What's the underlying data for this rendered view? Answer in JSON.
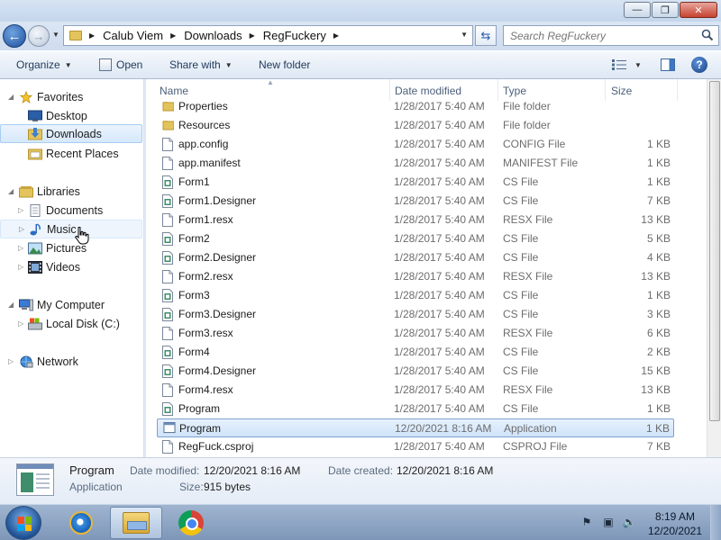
{
  "window": {
    "controls": {
      "minimize": "—",
      "maximize": "❐",
      "close": "✕"
    }
  },
  "address": {
    "crumbs": [
      "Calub Viem",
      "Downloads",
      "RegFuckery"
    ],
    "search_placeholder": "Search RegFuckery"
  },
  "toolbar": {
    "organize": "Organize",
    "open": "Open",
    "share_with": "Share with",
    "new_folder": "New folder"
  },
  "nav": {
    "favorites": "Favorites",
    "desktop": "Desktop",
    "downloads": "Downloads",
    "recent_places": "Recent Places",
    "libraries": "Libraries",
    "documents": "Documents",
    "music": "Music",
    "pictures": "Pictures",
    "videos": "Videos",
    "my_computer": "My Computer",
    "local_disk": "Local Disk (C:)",
    "network": "Network"
  },
  "columns": {
    "name": "Name",
    "date": "Date modified",
    "type": "Type",
    "size": "Size"
  },
  "files": [
    {
      "name": "Properties",
      "date": "1/28/2017 5:40 AM",
      "type": "File folder",
      "size": "",
      "icon": "folder"
    },
    {
      "name": "Resources",
      "date": "1/28/2017 5:40 AM",
      "type": "File folder",
      "size": "",
      "icon": "folder"
    },
    {
      "name": "app.config",
      "date": "1/28/2017 5:40 AM",
      "type": "CONFIG File",
      "size": "1 KB",
      "icon": "doc"
    },
    {
      "name": "app.manifest",
      "date": "1/28/2017 5:40 AM",
      "type": "MANIFEST File",
      "size": "1 KB",
      "icon": "doc"
    },
    {
      "name": "Form1",
      "date": "1/28/2017 5:40 AM",
      "type": "CS File",
      "size": "1 KB",
      "icon": "cs"
    },
    {
      "name": "Form1.Designer",
      "date": "1/28/2017 5:40 AM",
      "type": "CS File",
      "size": "7 KB",
      "icon": "cs"
    },
    {
      "name": "Form1.resx",
      "date": "1/28/2017 5:40 AM",
      "type": "RESX File",
      "size": "13 KB",
      "icon": "doc"
    },
    {
      "name": "Form2",
      "date": "1/28/2017 5:40 AM",
      "type": "CS File",
      "size": "5 KB",
      "icon": "cs"
    },
    {
      "name": "Form2.Designer",
      "date": "1/28/2017 5:40 AM",
      "type": "CS File",
      "size": "4 KB",
      "icon": "cs"
    },
    {
      "name": "Form2.resx",
      "date": "1/28/2017 5:40 AM",
      "type": "RESX File",
      "size": "13 KB",
      "icon": "doc"
    },
    {
      "name": "Form3",
      "date": "1/28/2017 5:40 AM",
      "type": "CS File",
      "size": "1 KB",
      "icon": "cs"
    },
    {
      "name": "Form3.Designer",
      "date": "1/28/2017 5:40 AM",
      "type": "CS File",
      "size": "3 KB",
      "icon": "cs"
    },
    {
      "name": "Form3.resx",
      "date": "1/28/2017 5:40 AM",
      "type": "RESX File",
      "size": "6 KB",
      "icon": "doc"
    },
    {
      "name": "Form4",
      "date": "1/28/2017 5:40 AM",
      "type": "CS File",
      "size": "2 KB",
      "icon": "cs"
    },
    {
      "name": "Form4.Designer",
      "date": "1/28/2017 5:40 AM",
      "type": "CS File",
      "size": "15 KB",
      "icon": "cs"
    },
    {
      "name": "Form4.resx",
      "date": "1/28/2017 5:40 AM",
      "type": "RESX File",
      "size": "13 KB",
      "icon": "doc"
    },
    {
      "name": "Program",
      "date": "1/28/2017 5:40 AM",
      "type": "CS File",
      "size": "1 KB",
      "icon": "cs"
    },
    {
      "name": "Program",
      "date": "12/20/2021 8:16 AM",
      "type": "Application",
      "size": "1 KB",
      "icon": "app",
      "selected": true
    },
    {
      "name": "RegFuck.csproj",
      "date": "1/28/2017 5:40 AM",
      "type": "CSPROJ File",
      "size": "7 KB",
      "icon": "doc"
    }
  ],
  "details": {
    "name": "Program",
    "type": "Application",
    "date_modified_label": "Date modified:",
    "date_modified": "12/20/2021 8:16 AM",
    "date_created_label": "Date created:",
    "date_created": "12/20/2021 8:16 AM",
    "size_label": "Size:",
    "size": "915 bytes"
  },
  "taskbar": {
    "time": "8:19 AM",
    "date": "12/20/2021"
  }
}
